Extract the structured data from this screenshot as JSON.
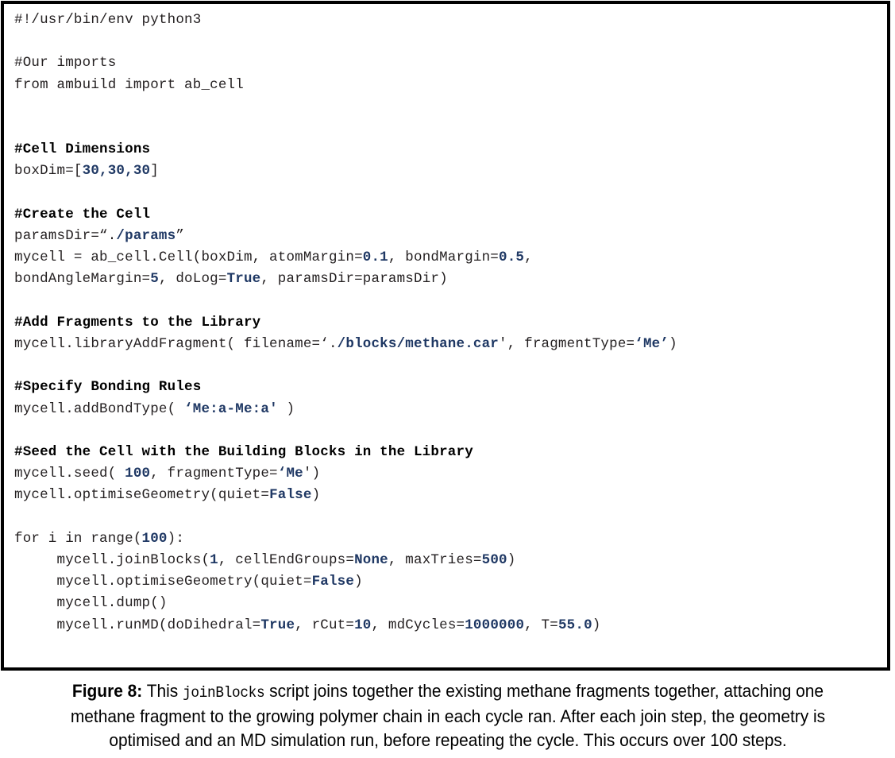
{
  "figure": {
    "caption_label": "Figure 8:",
    "caption_part1": " This ",
    "caption_mono": "joinBlocks",
    "caption_part2": " script joins together the existing methane fragments together, attaching one methane fragment to the growing polymer chain in each cycle ran. After each join step, the geometry is optimised and an MD simulation run, before repeating the cycle. This occurs over 100 steps."
  },
  "colors": {
    "border": "#000000",
    "code_text": "#231f20",
    "comment": "#000000",
    "value_highlight": "#1f3864",
    "background": "#ffffff"
  },
  "code": {
    "language": "python3",
    "lines": [
      {
        "id": "shebang",
        "tokens": [
          {
            "t": "plain",
            "v": "#!/usr/bin/env python3"
          }
        ]
      },
      {
        "id": "blank-1",
        "tokens": []
      },
      {
        "id": "comment-imports",
        "tokens": [
          {
            "t": "plain",
            "v": "#Our imports"
          }
        ]
      },
      {
        "id": "import-ab-cell",
        "tokens": [
          {
            "t": "plain",
            "v": "from ambuild import ab_cell"
          }
        ]
      },
      {
        "id": "blank-2",
        "tokens": []
      },
      {
        "id": "blank-3",
        "tokens": []
      },
      {
        "id": "comment-cell-dimensions",
        "tokens": [
          {
            "t": "cmt",
            "v": "#Cell Dimensions"
          }
        ]
      },
      {
        "id": "boxdim",
        "tokens": [
          {
            "t": "plain",
            "v": "boxDim=["
          },
          {
            "t": "val",
            "v": "30,30,30"
          },
          {
            "t": "plain",
            "v": "]"
          }
        ]
      },
      {
        "id": "blank-4",
        "tokens": []
      },
      {
        "id": "comment-create-cell",
        "tokens": [
          {
            "t": "cmt",
            "v": "#Create the Cell"
          }
        ]
      },
      {
        "id": "paramsdir",
        "tokens": [
          {
            "t": "plain",
            "v": "paramsDir=“."
          },
          {
            "t": "val",
            "v": "/params"
          },
          {
            "t": "plain",
            "v": "”"
          }
        ]
      },
      {
        "id": "mycell-cell",
        "tokens": [
          {
            "t": "plain",
            "v": "mycell = ab_cell.Cell(boxDim, atomMargin="
          },
          {
            "t": "val",
            "v": "0.1"
          },
          {
            "t": "plain",
            "v": ", bondMargin="
          },
          {
            "t": "val",
            "v": "0.5"
          },
          {
            "t": "plain",
            "v": ","
          }
        ]
      },
      {
        "id": "mycell-cell-cont",
        "tokens": [
          {
            "t": "plain",
            "v": "bondAngleMargin="
          },
          {
            "t": "val",
            "v": "5"
          },
          {
            "t": "plain",
            "v": ", doLog="
          },
          {
            "t": "val",
            "v": "True"
          },
          {
            "t": "plain",
            "v": ", paramsDir=paramsDir)"
          }
        ]
      },
      {
        "id": "blank-5",
        "tokens": []
      },
      {
        "id": "comment-add-fragments",
        "tokens": [
          {
            "t": "cmt",
            "v": "#Add Fragments to the Library"
          }
        ]
      },
      {
        "id": "library-add-fragment",
        "tokens": [
          {
            "t": "plain",
            "v": "mycell.libraryAddFragment( filename=‘."
          },
          {
            "t": "val",
            "v": "/blocks/methane.car"
          },
          {
            "t": "plain",
            "v": "', fragmentType="
          },
          {
            "t": "val",
            "v": "‘Me’"
          },
          {
            "t": "plain",
            "v": ")"
          }
        ]
      },
      {
        "id": "blank-6",
        "tokens": []
      },
      {
        "id": "comment-bonding-rules",
        "tokens": [
          {
            "t": "cmt",
            "v": "#Specify Bonding Rules"
          }
        ]
      },
      {
        "id": "add-bond-type",
        "tokens": [
          {
            "t": "plain",
            "v": "mycell.addBondType( "
          },
          {
            "t": "val",
            "v": "‘Me:a-Me:a'"
          },
          {
            "t": "plain",
            "v": " )"
          }
        ]
      },
      {
        "id": "blank-7",
        "tokens": []
      },
      {
        "id": "comment-seed-cell",
        "tokens": [
          {
            "t": "cmt",
            "v": "#Seed the Cell with the Building Blocks in the Library"
          }
        ]
      },
      {
        "id": "mycell-seed",
        "tokens": [
          {
            "t": "plain",
            "v": "mycell.seed( "
          },
          {
            "t": "val",
            "v": "100"
          },
          {
            "t": "plain",
            "v": ", fragmentType="
          },
          {
            "t": "val",
            "v": "‘Me"
          },
          {
            "t": "plain",
            "v": "')"
          }
        ]
      },
      {
        "id": "optimise-geometry-1",
        "tokens": [
          {
            "t": "plain",
            "v": "mycell.optimiseGeometry(quiet="
          },
          {
            "t": "val",
            "v": "False"
          },
          {
            "t": "plain",
            "v": ")"
          }
        ]
      },
      {
        "id": "blank-8",
        "tokens": []
      },
      {
        "id": "for-loop",
        "tokens": [
          {
            "t": "plain",
            "v": "for i in range("
          },
          {
            "t": "val",
            "v": "100"
          },
          {
            "t": "plain",
            "v": "):"
          }
        ]
      },
      {
        "id": "join-blocks",
        "tokens": [
          {
            "t": "plain",
            "v": "     mycell.joinBlocks("
          },
          {
            "t": "val",
            "v": "1"
          },
          {
            "t": "plain",
            "v": ", cellEndGroups="
          },
          {
            "t": "val",
            "v": "None"
          },
          {
            "t": "plain",
            "v": ", maxTries="
          },
          {
            "t": "val",
            "v": "500"
          },
          {
            "t": "plain",
            "v": ")"
          }
        ]
      },
      {
        "id": "optimise-geometry-2",
        "tokens": [
          {
            "t": "plain",
            "v": "     mycell.optimiseGeometry(quiet="
          },
          {
            "t": "val",
            "v": "False"
          },
          {
            "t": "plain",
            "v": ")"
          }
        ]
      },
      {
        "id": "dump",
        "tokens": [
          {
            "t": "plain",
            "v": "     mycell.dump()"
          }
        ]
      },
      {
        "id": "run-md",
        "tokens": [
          {
            "t": "plain",
            "v": "     mycell.runMD(doDihedral="
          },
          {
            "t": "val",
            "v": "True"
          },
          {
            "t": "plain",
            "v": ", rCut="
          },
          {
            "t": "val",
            "v": "10"
          },
          {
            "t": "plain",
            "v": ", mdCycles="
          },
          {
            "t": "val",
            "v": "1000000"
          },
          {
            "t": "plain",
            "v": ", T="
          },
          {
            "t": "val",
            "v": "55.0"
          },
          {
            "t": "plain",
            "v": ")"
          }
        ]
      }
    ]
  }
}
